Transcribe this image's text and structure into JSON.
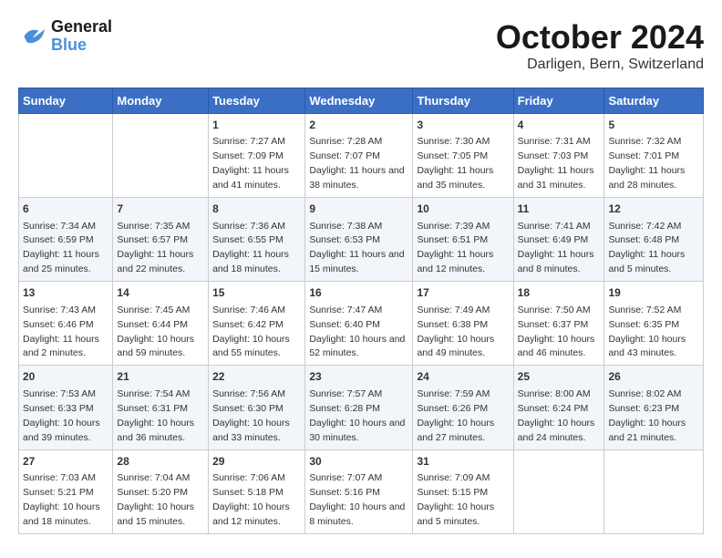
{
  "header": {
    "logo_line1": "General",
    "logo_line2": "Blue",
    "month": "October 2024",
    "location": "Darligen, Bern, Switzerland"
  },
  "days_of_week": [
    "Sunday",
    "Monday",
    "Tuesday",
    "Wednesday",
    "Thursday",
    "Friday",
    "Saturday"
  ],
  "weeks": [
    [
      {
        "day": "",
        "sunrise": "",
        "sunset": "",
        "daylight": ""
      },
      {
        "day": "",
        "sunrise": "",
        "sunset": "",
        "daylight": ""
      },
      {
        "day": "1",
        "sunrise": "Sunrise: 7:27 AM",
        "sunset": "Sunset: 7:09 PM",
        "daylight": "Daylight: 11 hours and 41 minutes."
      },
      {
        "day": "2",
        "sunrise": "Sunrise: 7:28 AM",
        "sunset": "Sunset: 7:07 PM",
        "daylight": "Daylight: 11 hours and 38 minutes."
      },
      {
        "day": "3",
        "sunrise": "Sunrise: 7:30 AM",
        "sunset": "Sunset: 7:05 PM",
        "daylight": "Daylight: 11 hours and 35 minutes."
      },
      {
        "day": "4",
        "sunrise": "Sunrise: 7:31 AM",
        "sunset": "Sunset: 7:03 PM",
        "daylight": "Daylight: 11 hours and 31 minutes."
      },
      {
        "day": "5",
        "sunrise": "Sunrise: 7:32 AM",
        "sunset": "Sunset: 7:01 PM",
        "daylight": "Daylight: 11 hours and 28 minutes."
      }
    ],
    [
      {
        "day": "6",
        "sunrise": "Sunrise: 7:34 AM",
        "sunset": "Sunset: 6:59 PM",
        "daylight": "Daylight: 11 hours and 25 minutes."
      },
      {
        "day": "7",
        "sunrise": "Sunrise: 7:35 AM",
        "sunset": "Sunset: 6:57 PM",
        "daylight": "Daylight: 11 hours and 22 minutes."
      },
      {
        "day": "8",
        "sunrise": "Sunrise: 7:36 AM",
        "sunset": "Sunset: 6:55 PM",
        "daylight": "Daylight: 11 hours and 18 minutes."
      },
      {
        "day": "9",
        "sunrise": "Sunrise: 7:38 AM",
        "sunset": "Sunset: 6:53 PM",
        "daylight": "Daylight: 11 hours and 15 minutes."
      },
      {
        "day": "10",
        "sunrise": "Sunrise: 7:39 AM",
        "sunset": "Sunset: 6:51 PM",
        "daylight": "Daylight: 11 hours and 12 minutes."
      },
      {
        "day": "11",
        "sunrise": "Sunrise: 7:41 AM",
        "sunset": "Sunset: 6:49 PM",
        "daylight": "Daylight: 11 hours and 8 minutes."
      },
      {
        "day": "12",
        "sunrise": "Sunrise: 7:42 AM",
        "sunset": "Sunset: 6:48 PM",
        "daylight": "Daylight: 11 hours and 5 minutes."
      }
    ],
    [
      {
        "day": "13",
        "sunrise": "Sunrise: 7:43 AM",
        "sunset": "Sunset: 6:46 PM",
        "daylight": "Daylight: 11 hours and 2 minutes."
      },
      {
        "day": "14",
        "sunrise": "Sunrise: 7:45 AM",
        "sunset": "Sunset: 6:44 PM",
        "daylight": "Daylight: 10 hours and 59 minutes."
      },
      {
        "day": "15",
        "sunrise": "Sunrise: 7:46 AM",
        "sunset": "Sunset: 6:42 PM",
        "daylight": "Daylight: 10 hours and 55 minutes."
      },
      {
        "day": "16",
        "sunrise": "Sunrise: 7:47 AM",
        "sunset": "Sunset: 6:40 PM",
        "daylight": "Daylight: 10 hours and 52 minutes."
      },
      {
        "day": "17",
        "sunrise": "Sunrise: 7:49 AM",
        "sunset": "Sunset: 6:38 PM",
        "daylight": "Daylight: 10 hours and 49 minutes."
      },
      {
        "day": "18",
        "sunrise": "Sunrise: 7:50 AM",
        "sunset": "Sunset: 6:37 PM",
        "daylight": "Daylight: 10 hours and 46 minutes."
      },
      {
        "day": "19",
        "sunrise": "Sunrise: 7:52 AM",
        "sunset": "Sunset: 6:35 PM",
        "daylight": "Daylight: 10 hours and 43 minutes."
      }
    ],
    [
      {
        "day": "20",
        "sunrise": "Sunrise: 7:53 AM",
        "sunset": "Sunset: 6:33 PM",
        "daylight": "Daylight: 10 hours and 39 minutes."
      },
      {
        "day": "21",
        "sunrise": "Sunrise: 7:54 AM",
        "sunset": "Sunset: 6:31 PM",
        "daylight": "Daylight: 10 hours and 36 minutes."
      },
      {
        "day": "22",
        "sunrise": "Sunrise: 7:56 AM",
        "sunset": "Sunset: 6:30 PM",
        "daylight": "Daylight: 10 hours and 33 minutes."
      },
      {
        "day": "23",
        "sunrise": "Sunrise: 7:57 AM",
        "sunset": "Sunset: 6:28 PM",
        "daylight": "Daylight: 10 hours and 30 minutes."
      },
      {
        "day": "24",
        "sunrise": "Sunrise: 7:59 AM",
        "sunset": "Sunset: 6:26 PM",
        "daylight": "Daylight: 10 hours and 27 minutes."
      },
      {
        "day": "25",
        "sunrise": "Sunrise: 8:00 AM",
        "sunset": "Sunset: 6:24 PM",
        "daylight": "Daylight: 10 hours and 24 minutes."
      },
      {
        "day": "26",
        "sunrise": "Sunrise: 8:02 AM",
        "sunset": "Sunset: 6:23 PM",
        "daylight": "Daylight: 10 hours and 21 minutes."
      }
    ],
    [
      {
        "day": "27",
        "sunrise": "Sunrise: 7:03 AM",
        "sunset": "Sunset: 5:21 PM",
        "daylight": "Daylight: 10 hours and 18 minutes."
      },
      {
        "day": "28",
        "sunrise": "Sunrise: 7:04 AM",
        "sunset": "Sunset: 5:20 PM",
        "daylight": "Daylight: 10 hours and 15 minutes."
      },
      {
        "day": "29",
        "sunrise": "Sunrise: 7:06 AM",
        "sunset": "Sunset: 5:18 PM",
        "daylight": "Daylight: 10 hours and 12 minutes."
      },
      {
        "day": "30",
        "sunrise": "Sunrise: 7:07 AM",
        "sunset": "Sunset: 5:16 PM",
        "daylight": "Daylight: 10 hours and 8 minutes."
      },
      {
        "day": "31",
        "sunrise": "Sunrise: 7:09 AM",
        "sunset": "Sunset: 5:15 PM",
        "daylight": "Daylight: 10 hours and 5 minutes."
      },
      {
        "day": "",
        "sunrise": "",
        "sunset": "",
        "daylight": ""
      },
      {
        "day": "",
        "sunrise": "",
        "sunset": "",
        "daylight": ""
      }
    ]
  ]
}
